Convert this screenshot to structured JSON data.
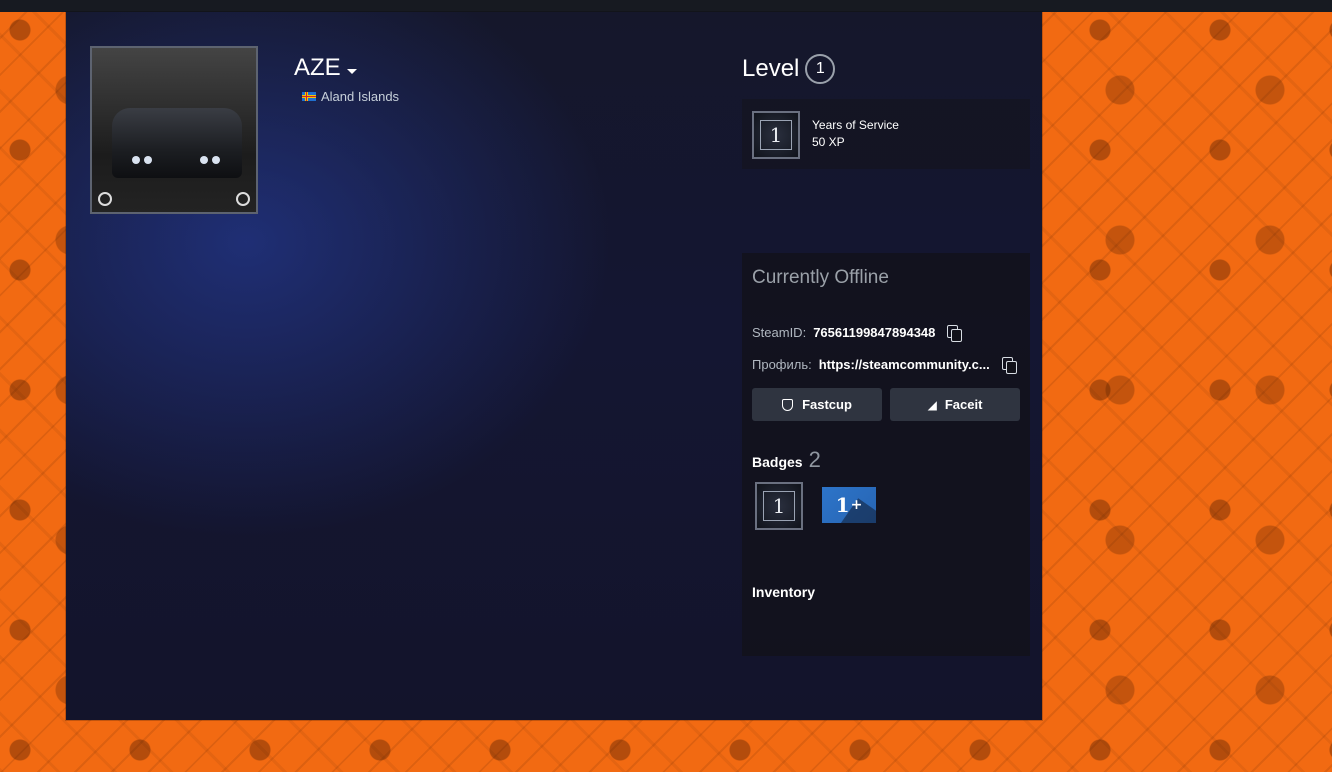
{
  "profile": {
    "name": "AZE",
    "location": "Aland Islands",
    "avatar_icon": "avatar-image"
  },
  "level": {
    "label": "Level",
    "value": "1"
  },
  "xp_badge": {
    "badge_number": "1",
    "title": "Years of Service",
    "xp": "50 XP"
  },
  "status": {
    "text": "Currently Offline"
  },
  "ids": {
    "steamid_label": "SteamID:",
    "steamid_value": "76561199847894348",
    "profile_label": "Профиль:",
    "profile_value": "https://steamcommunity.c..."
  },
  "buttons": {
    "fastcup": "Fastcup",
    "faceit": "Faceit"
  },
  "badges": {
    "label": "Badges",
    "count": "2",
    "items": [
      {
        "text": "1",
        "icon": "years-of-service-badge"
      },
      {
        "text": "1",
        "suffix": "+",
        "icon": "one-plus-badge"
      }
    ]
  },
  "inventory": {
    "label": "Inventory"
  },
  "colors": {
    "page_bg": "#f26a12",
    "topbar": "#171a21",
    "panel": "#141632",
    "button": "#2f3440",
    "badge_blue": "#2d74c9"
  }
}
